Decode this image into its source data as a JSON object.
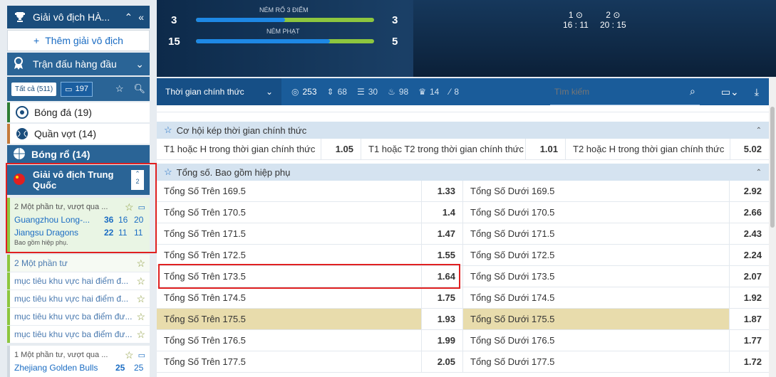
{
  "sidebar": {
    "championship_title": "Giải vô địch HÀ...",
    "add_championship": "Thêm giải vô địch",
    "top_matches": "Trận đấu hàng đầu",
    "filter_all": "Tất cả (511)",
    "filter_live_count": "197",
    "sports": [
      {
        "label": "Bóng đá (19)"
      },
      {
        "label": "Quần vợt (14)"
      }
    ],
    "basketball": "Bóng rổ (14)",
    "league": {
      "name": "Giải vô địch Trung Quốc",
      "count": "2"
    },
    "match1": {
      "period": "2 Một phần tư, vượt qua ...",
      "team1": "Guangzhou Long-...",
      "team1_scores": [
        "36",
        "16",
        "20"
      ],
      "team2": "Jiangsu Dragons",
      "team2_scores": [
        "22",
        "11",
        "11"
      ],
      "note": "Bao gồm hiệp phụ."
    },
    "sub_items": [
      "2 Một phần tư",
      "mục tiêu khu vực hai điểm đ...",
      "mục tiêu khu vực hai điểm đ...",
      "mục tiêu khu vực ba điểm đư...",
      "mục tiêu khu vực ba điểm đư..."
    ],
    "match2": {
      "period": "1 Một phần tư, vượt qua ...",
      "team1": "Zhejiang Golden Bulls",
      "team1_scores": [
        "25",
        "25"
      ]
    }
  },
  "banner": {
    "stat1": {
      "label": "NÉM RỔ 3 ĐIỂM",
      "left": "3",
      "right": "3",
      "left_share": 0.5
    },
    "stat2": {
      "label": "NÉM PHẠT",
      "left": "15",
      "right": "5",
      "left_share": 0.75
    },
    "timer1": {
      "label": "1",
      "time": "16 : 11"
    },
    "timer2": {
      "label": "2",
      "time": "20 : 15"
    }
  },
  "toolbar": {
    "dropdown": "Thời gian chính thức",
    "counts": [
      "253",
      "68",
      "30",
      "98",
      "14",
      "8"
    ],
    "search_placeholder": "Tìm kiếm"
  },
  "main": {
    "section1": {
      "title": "Cơ hội kép thời gian chính thức",
      "cells": [
        {
          "label": "T1 hoặc H trong thời gian chính thức",
          "odd": "1.05"
        },
        {
          "label": "T1 hoặc T2 trong thời gian chính thức",
          "odd": "1.01"
        },
        {
          "label": "T2 hoặc H trong thời gian chính thức",
          "odd": "5.02"
        }
      ]
    },
    "section2": {
      "title": "Tổng số. Bao gồm hiệp phụ",
      "rows": [
        {
          "over": "Tổng Số Trên 169.5",
          "over_odd": "1.33",
          "under": "Tổng Số Dưới 169.5",
          "under_odd": "2.92"
        },
        {
          "over": "Tổng Số Trên 170.5",
          "over_odd": "1.4",
          "under": "Tổng Số Dưới 170.5",
          "under_odd": "2.66"
        },
        {
          "over": "Tổng Số Trên 171.5",
          "over_odd": "1.47",
          "under": "Tổng Số Dưới 171.5",
          "under_odd": "2.43"
        },
        {
          "over": "Tổng Số Trên 172.5",
          "over_odd": "1.55",
          "under": "Tổng Số Dưới 172.5",
          "under_odd": "2.24"
        },
        {
          "over": "Tổng Số Trên 173.5",
          "over_odd": "1.64",
          "under": "Tổng Số Dưới 173.5",
          "under_odd": "2.07"
        },
        {
          "over": "Tổng Số Trên 174.5",
          "over_odd": "1.75",
          "under": "Tổng Số Dưới 174.5",
          "under_odd": "1.92"
        },
        {
          "over": "Tổng Số Trên 175.5",
          "over_odd": "1.93",
          "under": "Tổng Số Dưới 175.5",
          "under_odd": "1.87"
        },
        {
          "over": "Tổng Số Trên 176.5",
          "over_odd": "1.99",
          "under": "Tổng Số Dưới 176.5",
          "under_odd": "1.77"
        },
        {
          "over": "Tổng Số Trên 177.5",
          "over_odd": "2.05",
          "under": "Tổng Số Dưới 177.5",
          "under_odd": "1.72"
        }
      ]
    }
  },
  "colors": {
    "accent": "#1a5c9a",
    "highlight": "#e8dcac",
    "selection": "#e02020"
  }
}
